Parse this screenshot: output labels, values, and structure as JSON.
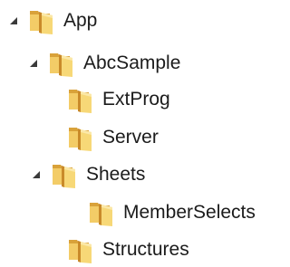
{
  "tree": {
    "nodes": [
      {
        "label": "App",
        "state": "expanded",
        "icon": "folder-icon",
        "accent": "#e8b84a"
      },
      {
        "label": "AbcSample",
        "state": "expanded",
        "icon": "folder-icon",
        "accent": "#e8b84a"
      },
      {
        "label": "ExtProg",
        "state": "leaf",
        "icon": "folder-icon",
        "accent": "#e8b84a"
      },
      {
        "label": "Server",
        "state": "leaf",
        "icon": "folder-icon",
        "accent": "#e8b84a"
      },
      {
        "label": "Sheets",
        "state": "expanded",
        "icon": "folder-icon",
        "accent": "#e8b84a"
      },
      {
        "label": "MemberSelects",
        "state": "leaf",
        "icon": "folder-icon",
        "accent": "#e8b84a"
      },
      {
        "label": "Structures",
        "state": "leaf",
        "icon": "folder-icon",
        "accent": "#e8b84a"
      }
    ]
  }
}
